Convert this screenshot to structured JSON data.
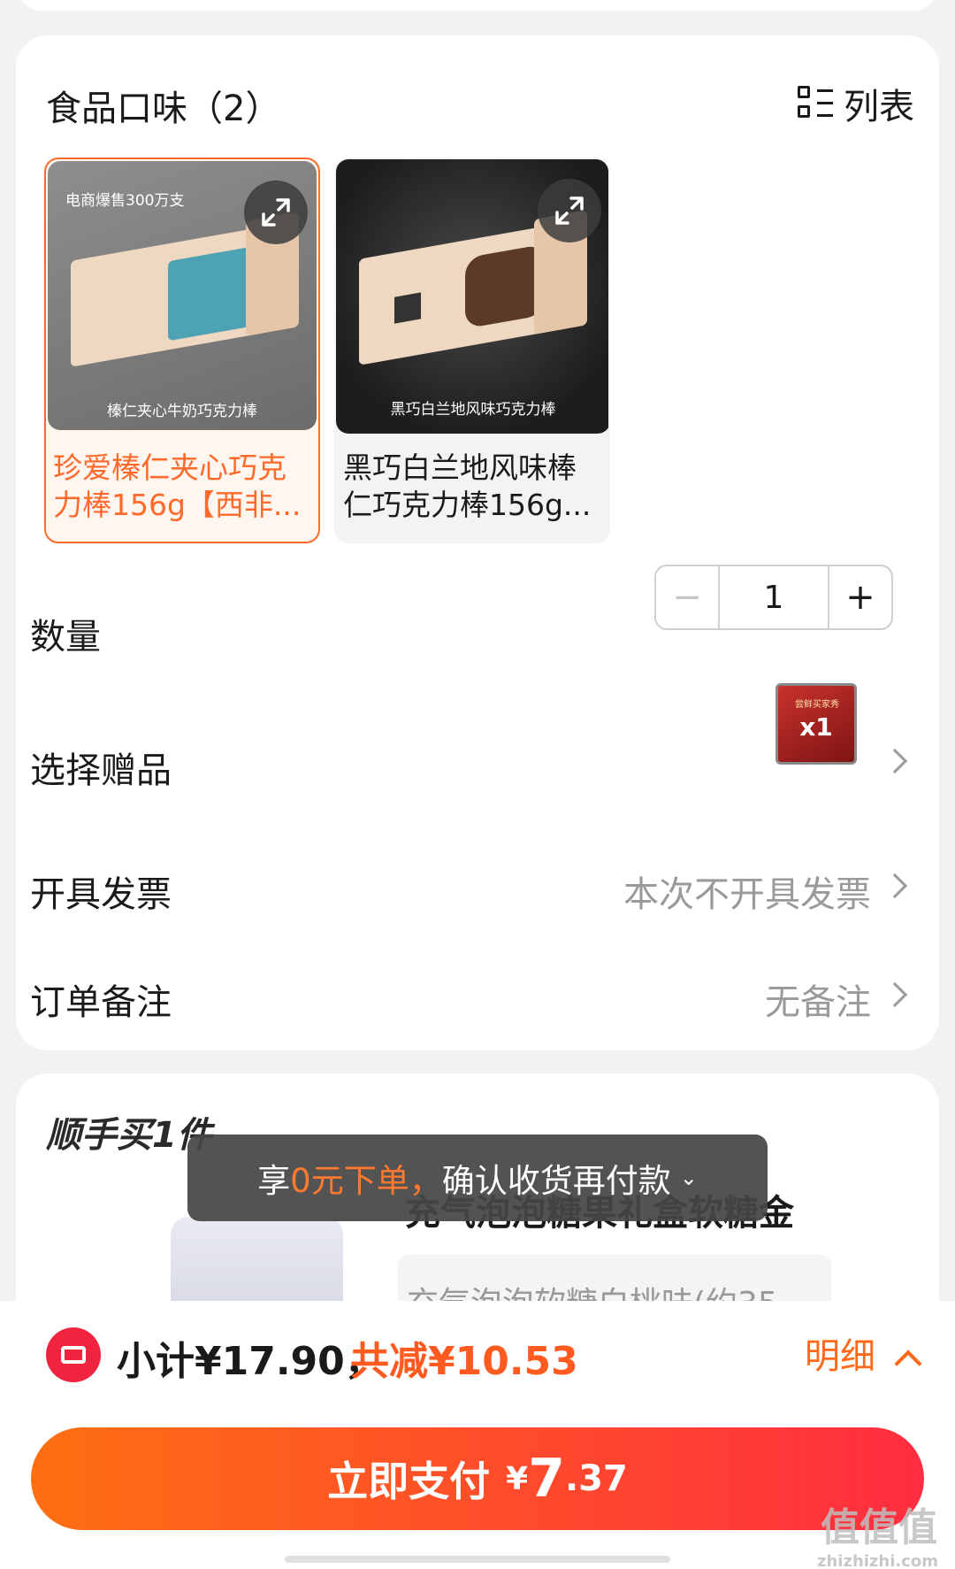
{
  "flavor": {
    "title": "食品口味（2）",
    "list_toggle_label": "列表",
    "options": [
      {
        "promo_text": "电商爆售300万支",
        "image_caption": "榛仁夹心牛奶巧克力棒",
        "name": "珍爱榛仁夹心巧克力棒156g【西非...",
        "selected": true
      },
      {
        "promo_text": "",
        "image_caption": "黑巧白兰地风味巧克力棒",
        "name": "黑巧白兰地风味棒仁巧克力棒156g...",
        "selected": false
      }
    ]
  },
  "quantity": {
    "label": "数量",
    "minus": "−",
    "value": "1",
    "plus": "+"
  },
  "gift": {
    "label": "选择赠品",
    "thumb_text": "尝鲜买家秀",
    "thumb_count": "x1"
  },
  "invoice": {
    "label": "开具发票",
    "value": "本次不开具发票"
  },
  "remark": {
    "label": "订单备注",
    "value": "无备注"
  },
  "addon": {
    "title": "顺手买1件",
    "product_name": "充气泡泡糖果礼盒软糖金",
    "variant": "充气泡泡软糖白桃味(约35"
  },
  "toast": {
    "prefix": "享",
    "highlight": "0元下单，",
    "suffix": "确认收货再付款",
    "chevron": "⌄"
  },
  "footer": {
    "subtotal": "小计¥17.90，",
    "discount": "共减¥10.53",
    "detail_label": "明细",
    "pay_label": "立即支付",
    "currency": "¥",
    "amount_int": "7",
    "amount_dec": ".37"
  },
  "watermark": {
    "logo": "值值值",
    "site": "zhizhizhi.com"
  },
  "colors": {
    "accent": "#ff6a2b",
    "pay_start": "#ff6f12",
    "pay_end": "#ff2d40",
    "coupon": "#f0243e"
  }
}
